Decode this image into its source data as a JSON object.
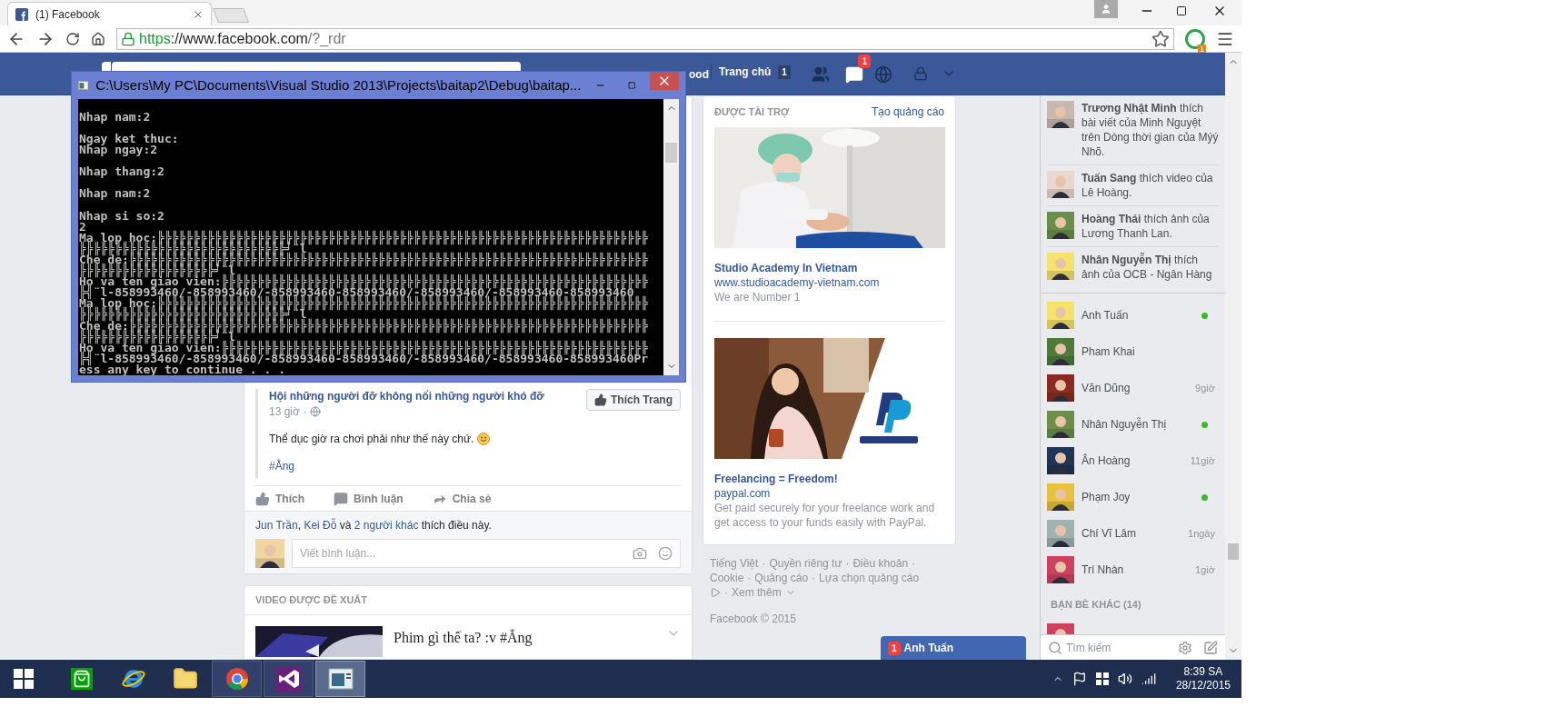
{
  "browser": {
    "tab": {
      "title": "(1) Facebook",
      "selected": true
    },
    "url": {
      "scheme": "https",
      "host": "://www.facebook.com",
      "path": "/?_rdr"
    },
    "extension_badge": "1"
  },
  "topbar": {
    "profile_name": "ood",
    "home_label": "Trang chủ",
    "home_count": "1",
    "messages_badge": "1"
  },
  "post": {
    "page_name": "Hội những người đỡ không nổi những người khó đỡ",
    "time": "13 giờ ·",
    "like_page_button": "Thích Trang",
    "text": "Thể dục giờ ra chơi phải như thế này chứ.",
    "hashtag": "#Ẳng",
    "actions": [
      {
        "kind": "like",
        "label": "Thích"
      },
      {
        "kind": "comment",
        "label": "Bình luận"
      },
      {
        "kind": "share",
        "label": "Chia sẻ"
      }
    ],
    "likes": {
      "first": "Jun Trần",
      "comma": ",",
      "second": "Kei Đỗ",
      "and": "và",
      "others": "2 người khác",
      "suffix": "thích điều này."
    },
    "comment_placeholder": "Viết bình luận..."
  },
  "suggested_video": {
    "header": "VIDEO ĐƯỢC ĐỀ XUẤT",
    "title": "Phim gì thế ta? :v #Ẳng"
  },
  "ads": {
    "header": "ĐƯỢC TÀI TRỢ",
    "create_link": "Tạo quảng cáo",
    "items": [
      {
        "kind": "clinic",
        "title": "Studio Academy In Vietnam",
        "url": "www.studioacademy-vietnam.com",
        "description": "We are Number 1"
      },
      {
        "kind": "cafe",
        "title": "Freelancing = Freedom!",
        "url": "paypal.com",
        "description": "Get paid securely for your freelance work and get access to your funds easily with PayPal."
      }
    ]
  },
  "footer": {
    "separator": "·",
    "links": [
      "Tiếng Việt",
      "Quyền riêng tư",
      "Điều khoản",
      "Cookie",
      "Quảng cáo",
      "Lựa chọn quảng cáo"
    ],
    "more": "Xem thêm",
    "copyright": "Facebook © 2015"
  },
  "ticker": [
    {
      "text": "**Trương Nhật Minh** thích bài viết của Minh Nguyệt trên Dòng thời gian của Mýý Nhõ."
    },
    {
      "text": "**Tuấn Sang** thích video của Lê Hoàng."
    },
    {
      "text": "**Hoàng Thái** thích ảnh của Lương Thanh Lan."
    },
    {
      "text": "**Nhân Nguyễn Thị** thích ảnh của OCB - Ngân Hàng"
    }
  ],
  "chat": [
    {
      "name": "Anh Tuấn",
      "online": true
    },
    {
      "name": "Pham Khai",
      "online": false
    },
    {
      "name": "Văn Dũng",
      "online": false,
      "last_active": "9giờ"
    },
    {
      "name": "Nhân Nguyễn Thị",
      "online": true
    },
    {
      "name": "Ân Hoàng",
      "online": false,
      "last_active": "11giờ"
    },
    {
      "name": "Phạm Joy",
      "online": true
    },
    {
      "name": "Chí Vĩ Lâm",
      "online": false,
      "last_active": "1ngày"
    },
    {
      "name": "Trí Nhàn",
      "online": false,
      "last_active": "1giờ"
    }
  ],
  "other_friends_header": "BẠN BÈ KHÁC (14)",
  "chat_search_placeholder": "Tìm kiếm",
  "chat_tab": {
    "badge": "1",
    "name": "Anh Tuấn"
  },
  "console": {
    "title": "C:\\Users\\My PC\\Documents\\Visual Studio 2013\\Projects\\baitap2\\Debug\\baitap...",
    "lines": [
      {
        "text": "Nhap nam:2",
        "gap_before": true
      },
      {
        "text": "Ngay ket thuc:",
        "gap_before": true
      },
      {
        "text": "Nhap ngay:2",
        "gap_before": false
      },
      {
        "text": "Nhap thang:2",
        "gap_before": true
      },
      {
        "text": "Nhap nam:2",
        "gap_before": true
      },
      {
        "text": "Nhap si so:2",
        "gap_before": true
      },
      {
        "text": "2",
        "gap_before": false
      },
      "Ma lop hoc:╠╠╠╠╠╠╠╠╠╠╠╠╠╠╠╠╠╠╠╠╠╠╠╠╠╠╠╠╠╠╠╠╠╠╠╠╠╠╠╠╠╠╠╠╠╠╠╠╠╠╠╠╠╠╠╠╠╠╠╠╠╠╠╠╠╠╠╠╠",
      "╠╠╠╠╠╠╠╠╠╠╠╠╠╠╠╠╠╠╠╠╠╠╠╠╠╠╠╠╠╛¨l",
      "Che de:╠╠╠╠╠╠╠╠╠╠╠╠╠╠╠╠╠╠╠╠╠╠╠╠╠╠╠╠╠╠╠╠╠╠╠╠╠╠╠╠╠╠╠╠╠╠╠╠╠╠╠╠╠╠╠╠╠╠╠╠╠╠╠╠╠╠╠╠╠╠╠╠╠",
      "╠╠╠╠╠╠╠╠╠╠╠╠╠╠╠╠╠╠╠╛¨l",
      "Ho va ten giao vien:╠╠╠╠╠╠╠╠╠╠╠╠╠╠╠╠╠╠╠╠╠╠╠╠╠╠╠╠╠╠╠╠╠╠╠╠╠╠╠╠╠╠╠╠╠╠╠╠╠╠╠╠╠╠╠╠╠╠╠╠",
      "╠╣¨l-858993460/-858993460/-858993460-858993460/-858993460/-858993460-858993460",
      "Ma lop hoc:╠╠╠╠╠╠╠╠╠╠╠╠╠╠╠╠╠╠╠╠╠╠╠╠╠╠╠╠╠╠╠╠╠╠╠╠╠╠╠╠╠╠╠╠╠╠╠╠╠╠╠╠╠╠╠╠╠╠╠╠╠╠╠╠╠╠╠╠╠",
      "╠╠╠╠╠╠╠╠╠╠╠╠╠╠╠╠╠╠╠╠╠╠╠╠╠╠╠╠╠╛¨l",
      "Che de:╠╠╠╠╠╠╠╠╠╠╠╠╠╠╠╠╠╠╠╠╠╠╠╠╠╠╠╠╠╠╠╠╠╠╠╠╠╠╠╠╠╠╠╠╠╠╠╠╠╠╠╠╠╠╠╠╠╠╠╠╠╠╠╠╠╠╠╠╠╠╠╠╠",
      "╠╠╠╠╠╠╠╠╠╠╠╠╠╠╠╠╠╠╠╛¨l",
      "Ho va ten giao vien:╠╠╠╠╠╠╠╠╠╠╠╠╠╠╠╠╠╠╠╠╠╠╠╠╠╠╠╠╠╠╠╠╠╠╠╠╠╠╠╠╠╠╠╠╠╠╠╠╠╠╠╠╠╠╠╠╠╠╠╠",
      "╠╣¨l-858993460/-858993460/-858993460-858993460/-858993460/-858993460-858993460Pr",
      "ess any key to continue . . ."
    ]
  },
  "taskbar": {
    "apps": [
      {
        "kind": "store",
        "running": false,
        "selected": false
      },
      {
        "kind": "ie",
        "running": false,
        "selected": false
      },
      {
        "kind": "explorer",
        "running": false,
        "selected": false
      },
      {
        "kind": "chrome",
        "running": true,
        "selected": false
      },
      {
        "kind": "vs",
        "running": true,
        "selected": false
      },
      {
        "kind": "console",
        "running": true,
        "selected": true
      }
    ],
    "time": "8:39 SA",
    "date": "28/12/2015"
  }
}
